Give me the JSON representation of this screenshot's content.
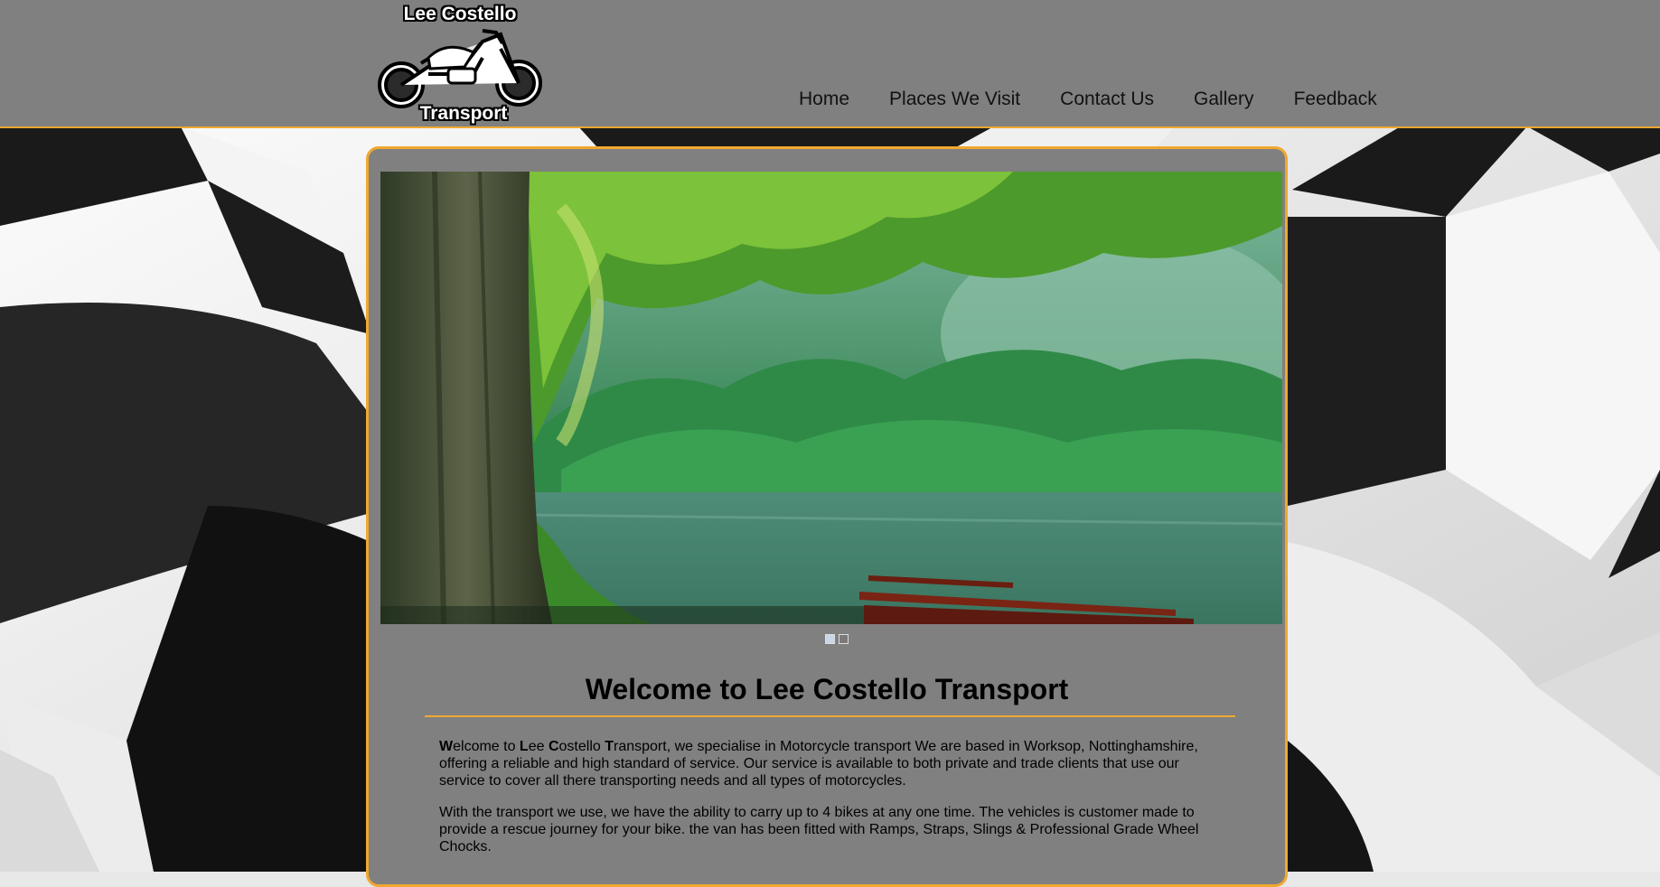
{
  "brand": {
    "logo_top": "Lee Costello",
    "logo_bottom": "Transport"
  },
  "nav": {
    "items": [
      "Home",
      "Places We Visit",
      "Contact Us",
      "Gallery",
      "Feedback"
    ]
  },
  "slider": {
    "slide_count": 2,
    "active_index": 0,
    "image": "forest-lake-scene"
  },
  "main": {
    "title": "Welcome to Lee Costello Transport",
    "para1": {
      "w": "W",
      "elcome_to": "elcome to ",
      "l": "L",
      "ee": "ee ",
      "c": "C",
      "ostello": "ostello ",
      "t": "T",
      "rest": "ransport, we specialise in Motorcycle transport We are based in Worksop, Nottinghamshire, offering a reliable and high standard of service. Our service is available to both private and trade clients that use our service to cover all there transporting needs and all types of motorcycles."
    },
    "para2": "With the transport we use, we have the ability to carry up to 4 bikes at any one time. The vehicles is customer made to provide a rescue journey for your bike. the van has been fitted with Ramps, Straps, Slings & Professional Grade Wheel Chocks."
  },
  "colors": {
    "header_bg": "#808080",
    "accent": "#f0a830",
    "panel_bg": "#808080"
  }
}
